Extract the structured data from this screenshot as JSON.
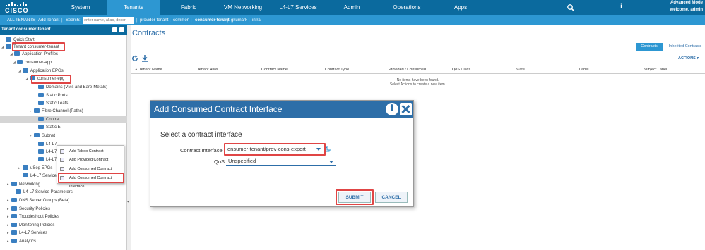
{
  "topnav": {
    "logo_text": "CISCO",
    "tabs": [
      {
        "label": "System"
      },
      {
        "label": "Tenants"
      },
      {
        "label": "Fabric"
      },
      {
        "label": "VM Networking"
      },
      {
        "label": "L4-L7 Services"
      },
      {
        "label": "Admin"
      },
      {
        "label": "Operations"
      },
      {
        "label": "Apps"
      }
    ],
    "active_tab": "Tenants",
    "mode": "Advanced Mode",
    "welcome": "welcome, admin",
    "info_glyph": "i",
    "icons": [
      "search-icon",
      "info-icon"
    ]
  },
  "subnav": {
    "all_tenants": "ALL TENANTS",
    "sep": "|",
    "add_tenant": "Add Tenant",
    "search_label": "Search:",
    "search_placeholder": "enter name, alias, descr",
    "links": [
      "provider-tenant",
      "common",
      "consumer-tenant",
      "gkumark",
      "infra"
    ]
  },
  "left_panel": {
    "title": "Tenant consumer-tenant",
    "tree": [
      "Quick Start",
      "Tenant consumer-tenant",
      "Application Profiles",
      "consumer-app",
      "Application EPGs",
      "consumer-epg",
      "Domains (VMs and Bare-Metals)",
      "Static Ports",
      "Static Leafs",
      "Fibre Channel (Paths)",
      "Contra",
      "Static E",
      "Subnet",
      "L4-L7",
      "L4-L7",
      "L4-L7 Service Parameters",
      "uSeg EPGs",
      "L4-L7 Service Parameters",
      "Networking",
      "L4-L7 Service Parameters",
      "DNS Server Groups (Beta)",
      "Security Policies",
      "Troubleshoot Policies",
      "Monitoring Policies",
      "L4-L7 Services",
      "Analytics"
    ],
    "context_menu": [
      "Add Taboo Contract",
      "Add Provided Contract",
      "Add Consumed Contract",
      "Add Consumed Contract Interface"
    ]
  },
  "main": {
    "title": "Contracts",
    "tabs": [
      "Contracts",
      "Inherited Contracts"
    ],
    "actions": "ACTIONS ▾",
    "columns": [
      "▲ Tenant Name",
      "Tenant Alias",
      "Contract Name",
      "Contract Type",
      "Provided / Consumed",
      "QoS Class",
      "State",
      "Label",
      "Subject Label"
    ],
    "empty_line1": "No items have been found.",
    "empty_line2": "Select Actions to create a new item."
  },
  "dialog": {
    "title": "Add Consumed Contract Interface",
    "info_glyph": "i",
    "subtitle": "Select a contract interface",
    "ci_label": "Contract Interface:",
    "ci_value": "onsumer-tenant/prov-cons-export",
    "qos_label": "QoS:",
    "qos_value": "Unspecified",
    "submit": "SUBMIT",
    "cancel": "CANCEL"
  },
  "colors": {
    "nav_dark": "#0b6a9e",
    "nav_light": "#2d97d2",
    "dialog_header": "#2d6ea8",
    "highlight": "#e04545"
  }
}
